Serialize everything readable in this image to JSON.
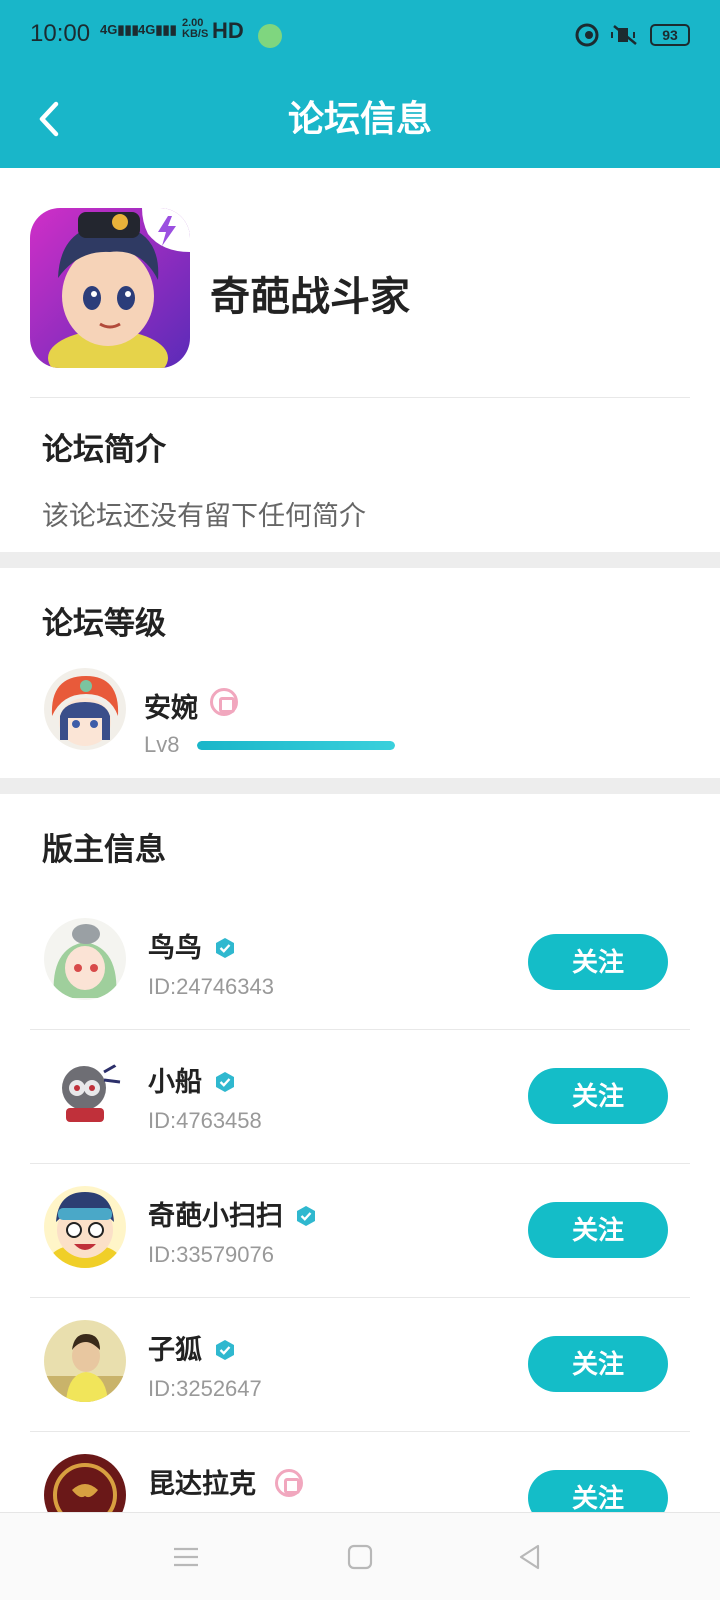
{
  "status_bar": {
    "time": "10:00",
    "signal1": "4G",
    "signal2": "4G",
    "net_speed_value": "2.00",
    "net_speed_unit": "KB/S",
    "hd": "HD",
    "battery": "93"
  },
  "nav": {
    "title": "论坛信息"
  },
  "forum": {
    "name": "奇葩战斗家"
  },
  "intro": {
    "title": "论坛简介",
    "text": "该论坛还没有留下任何简介"
  },
  "level": {
    "title": "论坛等级",
    "user_name": "安婉",
    "level_label": "Lv8",
    "progress": 1.0
  },
  "moderators": {
    "title": "版主信息",
    "follow_label": "关注",
    "items": [
      {
        "name": "鸟鸟",
        "id": "ID:24746343"
      },
      {
        "name": "小船",
        "id": "ID:4763458"
      },
      {
        "name": "奇葩小扫扫",
        "id": "ID:33579076"
      },
      {
        "name": "子狐",
        "id": "ID:3252647"
      },
      {
        "name": "昆达拉克",
        "id": ""
      }
    ]
  },
  "colors": {
    "accent": "#19b6c9",
    "button": "#14bdc8",
    "verified": "#2fb8cf",
    "badge_pink": "#f1a7be"
  }
}
